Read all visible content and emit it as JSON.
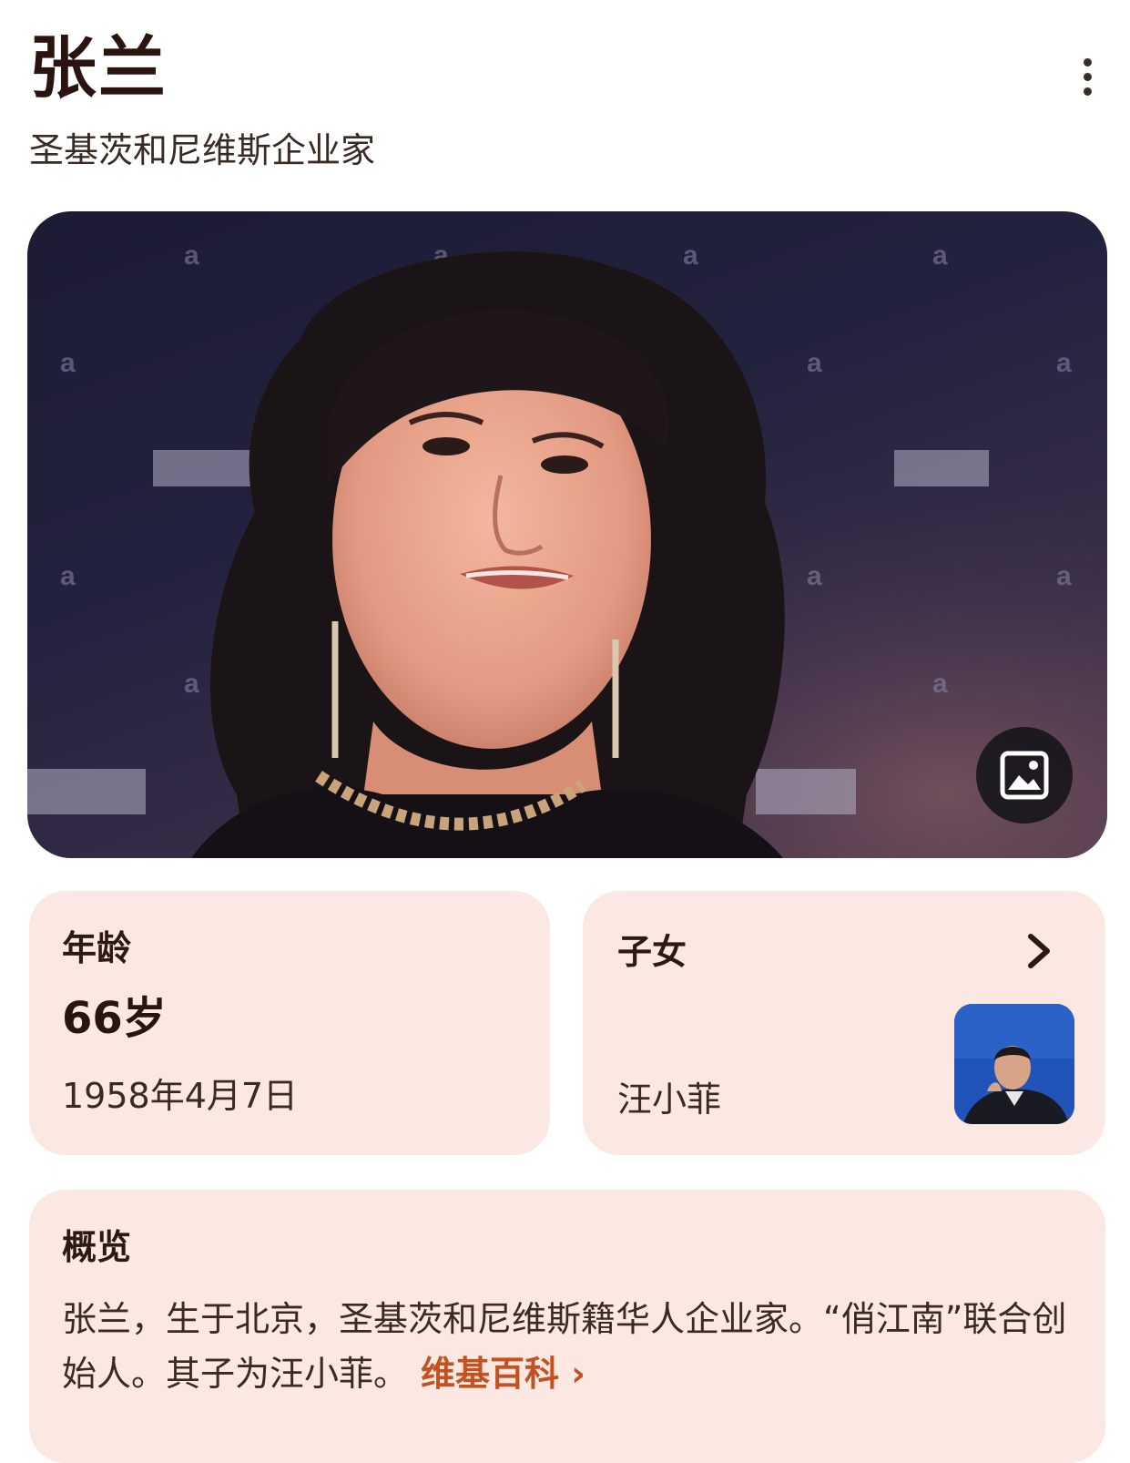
{
  "header": {
    "title": "张兰",
    "subtitle": "圣基茨和尼维斯企业家"
  },
  "age_card": {
    "label": "年龄",
    "value": "66岁",
    "birth_date": "1958年4月7日"
  },
  "children_card": {
    "label": "子女",
    "name": "汪小菲"
  },
  "overview": {
    "label": "概览",
    "text": "张兰，生于北京，圣基茨和尼维斯籍华人企业家。“俏江南”联合创始人。其子为汪小菲。",
    "link_label": "维基百科 ›"
  },
  "icons": {
    "more": "more-vert-icon",
    "image": "image-gallery-icon",
    "chevron": "chevron-right-icon"
  },
  "colors": {
    "card_background": "#fce8e3",
    "link": "#c2521f",
    "title": "#2b1410"
  }
}
